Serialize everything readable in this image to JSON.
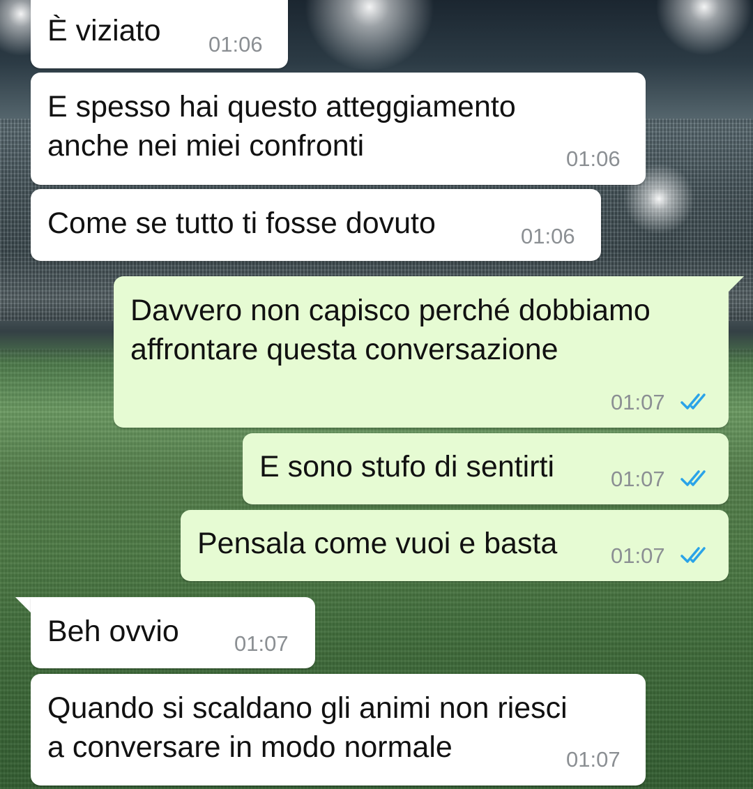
{
  "messages": [
    {
      "direction": "incoming",
      "text_lines": [
        "È viziato"
      ],
      "time": "01:06"
    },
    {
      "direction": "incoming",
      "text_lines": [
        "E spesso hai questo atteggiamento",
        "anche nei miei confronti"
      ],
      "time": "01:06"
    },
    {
      "direction": "incoming",
      "text_lines": [
        "Come se tutto ti fosse dovuto"
      ],
      "time": "01:06"
    },
    {
      "direction": "outgoing",
      "text_lines": [
        "Davvero non capisco perché dobbiamo",
        "affrontare questa conversazione"
      ],
      "time": "01:07",
      "status": "read"
    },
    {
      "direction": "outgoing",
      "text_lines": [
        "E sono stufo di sentirti"
      ],
      "time": "01:07",
      "status": "read"
    },
    {
      "direction": "outgoing",
      "text_lines": [
        "Pensala come vuoi e basta"
      ],
      "time": "01:07",
      "status": "read"
    },
    {
      "direction": "incoming",
      "text_lines": [
        "Beh ovvio"
      ],
      "time": "01:07"
    },
    {
      "direction": "incoming",
      "text_lines": [
        "Quando si scaldano gli animi non riesci",
        "a conversare in modo normale"
      ],
      "time": "01:07"
    }
  ],
  "colors": {
    "incoming_bubble": "#ffffff",
    "outgoing_bubble": "#e6fbd3",
    "text": "#111111",
    "timestamp": "#8b8f93",
    "read_ticks": "#2aa3e8"
  },
  "icons": {
    "read_receipt": "double-check-icon"
  },
  "wallpaper": "stadium-wallpaper"
}
